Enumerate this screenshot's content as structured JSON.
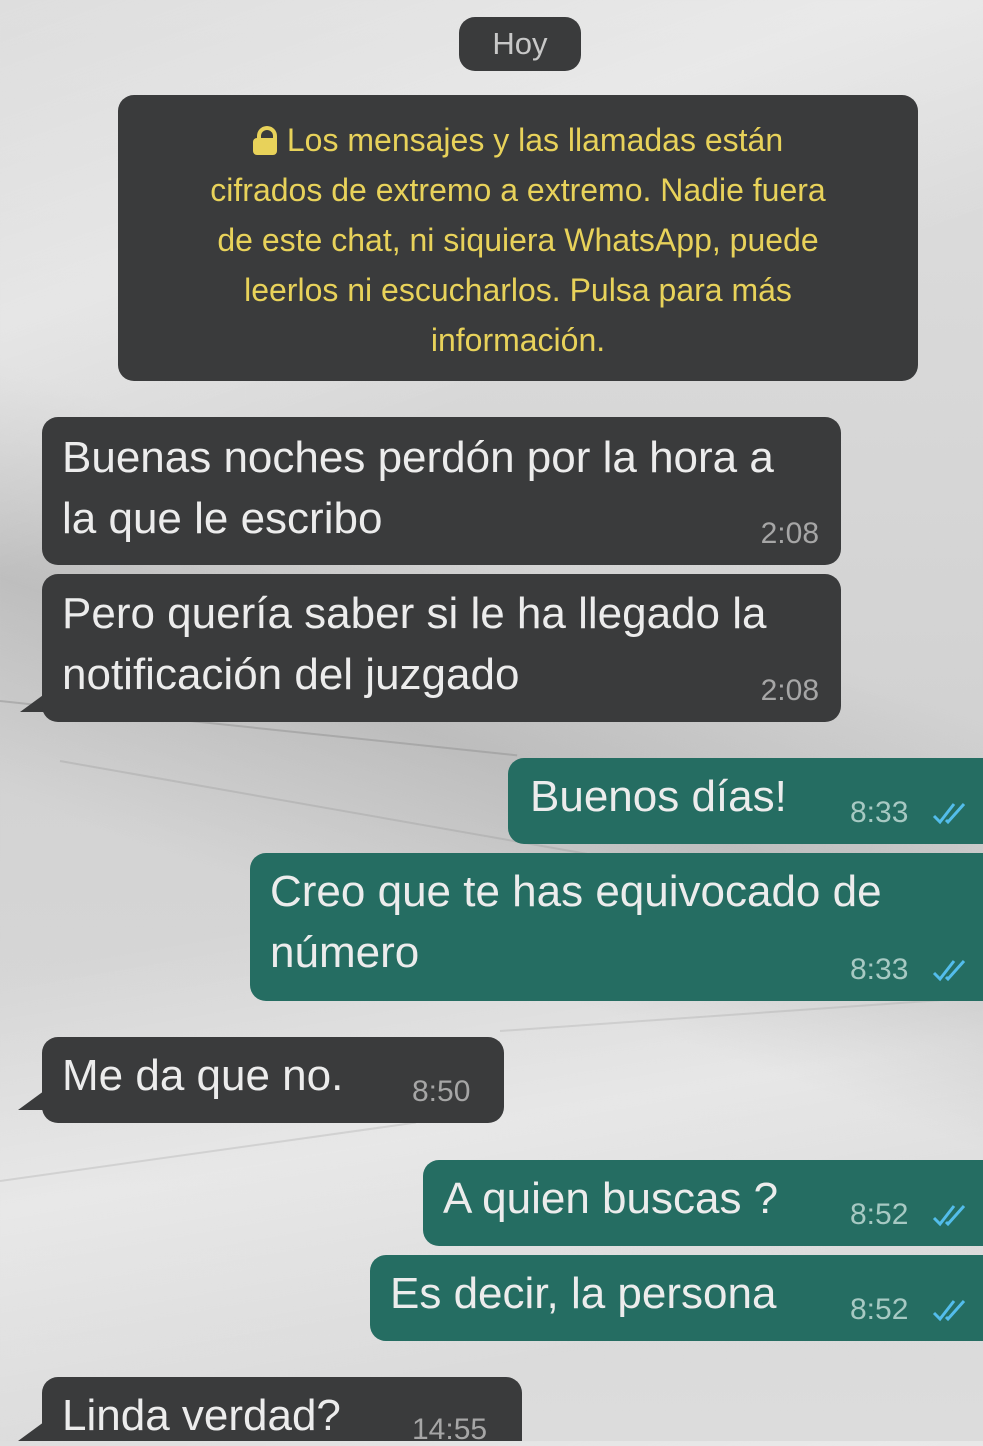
{
  "date_pill": "Hoy",
  "notice": {
    "icon": "lock-icon",
    "lines": [
      "Los mensajes y las llamadas están",
      "cifrados de extremo a extremo. Nadie fuera",
      "de este chat, ni siquiera WhatsApp, puede",
      "leerlos ni escucharlos. Pulsa para más",
      "información."
    ]
  },
  "colors": {
    "incoming_bubble": "#3a3b3c",
    "outgoing_bubble": "#256d62",
    "notice_text": "#e8d25a",
    "read_ticks": "#53bdeb"
  },
  "messages": [
    {
      "direction": "incoming",
      "lines": [
        "Buenas noches perdón por la hora a",
        "la que le escribo"
      ],
      "time": "2:08"
    },
    {
      "direction": "incoming",
      "lines": [
        "Pero quería saber si le ha llegado la",
        "notificación del juzgado"
      ],
      "time": "2:08"
    },
    {
      "direction": "outgoing",
      "lines": [
        "Buenos días!"
      ],
      "time": "8:33",
      "status": "read"
    },
    {
      "direction": "outgoing",
      "lines": [
        "Creo que te has equivocado de",
        "número"
      ],
      "time": "8:33",
      "status": "read"
    },
    {
      "direction": "incoming",
      "lines": [
        "Me da que no."
      ],
      "time": "8:50"
    },
    {
      "direction": "outgoing",
      "lines": [
        "A quien buscas ?"
      ],
      "time": "8:52",
      "status": "read"
    },
    {
      "direction": "outgoing",
      "lines": [
        "Es decir, la persona"
      ],
      "time": "8:52",
      "status": "read"
    },
    {
      "direction": "incoming",
      "lines": [
        "Linda verdad?"
      ],
      "time": "14:55"
    }
  ]
}
